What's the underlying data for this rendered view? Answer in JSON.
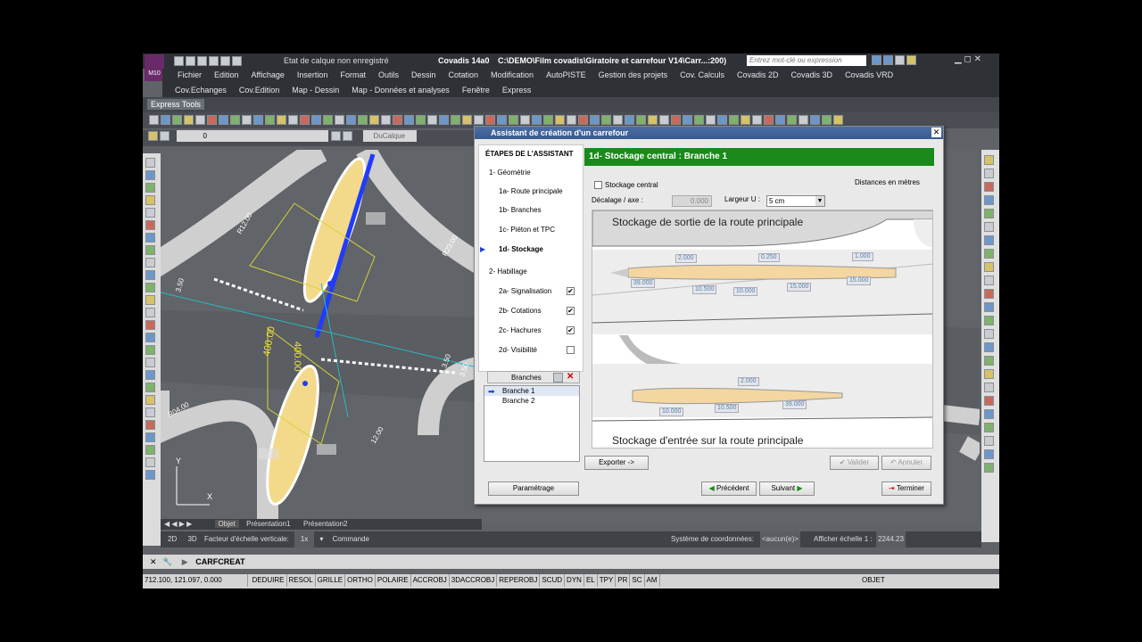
{
  "app": {
    "title": "Covadis 14a0",
    "path": "C:\\DEMO\\Film covadis\\Giratoire et carrefour V14\\Carr...:200)",
    "search_placeholder": "Entrez mot-clé ou expression",
    "layer_state": "Etat de calque non enregistré",
    "logo": "M10"
  },
  "menu": [
    "Fichier",
    "Edition",
    "Affichage",
    "Insertion",
    "Format",
    "Outils",
    "Dessin",
    "Cotation",
    "Modification",
    "AutoPISTE",
    "Gestion des projets",
    "Cov. Calculs",
    "Covadis 2D",
    "Covadis 3D",
    "Covadis VRD"
  ],
  "menu2": [
    "Cov.Echanges",
    "Cov.Edition",
    "Map - Dessin",
    "Map - Données et analyses",
    "Fenêtre",
    "Express"
  ],
  "toolbar": {
    "express_tools": "Express Tools",
    "layer_field": "0",
    "dupl_field": "DuCalque"
  },
  "dialog": {
    "title": "Assistant de création d'un carrefour",
    "steps_title": "ÉTAPES DE L'ASSISTANT",
    "steps": [
      {
        "label": "1- Géométrie"
      },
      {
        "label": "1a- Route principale"
      },
      {
        "label": "1b- Branches"
      },
      {
        "label": "1c- Piéton et TPC"
      },
      {
        "label": "1d- Stockage",
        "active": true
      },
      {
        "label": "2- Habillage"
      },
      {
        "label": "2a- Signalisation",
        "checked": true
      },
      {
        "label": "2b- Cotations",
        "checked": true
      },
      {
        "label": "2c- Hachures",
        "checked": true
      },
      {
        "label": "2d- Visibilité",
        "checked": false
      }
    ],
    "branches_label": "Branches",
    "branches": [
      "Branche 1",
      "Branche 2"
    ],
    "panel_title": "1d- Stockage central : Branche 1",
    "stockage_central": "Stockage central",
    "distances": "Distances en mètres",
    "decalage_label": "Décalage / axe :",
    "decalage_value": "0.000",
    "largeur_label": "Largeur U :",
    "largeur_value": "5 cm",
    "diagram_title_top": "Stockage de sortie de la route principale",
    "diagram_title_bottom": "Stockage d'entrée sur la route principale",
    "dims_top": [
      "2.000",
      "0.250",
      "1.000",
      "39.000",
      "10.500",
      "10.000",
      "15.000",
      "15.000"
    ],
    "dims_bottom": [
      "2.000",
      "10.000",
      "10.500",
      "39.000"
    ],
    "buttons": {
      "exporter": "Exporter ->",
      "valider": "Valider",
      "annuler": "Annuler",
      "parametrage": "Paramétrage",
      "precedent": "Précédent",
      "suivant": "Suivant",
      "terminer": "Terminer"
    }
  },
  "canvas": {
    "labels": [
      "R12.00",
      "R23.00",
      "3.50",
      "400.00",
      "400.00",
      "3.50",
      "R04.00",
      "12.00",
      "3.50"
    ]
  },
  "tabs": [
    "Objet",
    "Présentation1",
    "Présentation2"
  ],
  "statusbar": {
    "b2d": "2D",
    "b3d": "3D",
    "facteur": "Facteur d'échelle verticale:",
    "facteur_val": "1x",
    "commande": "Commande",
    "systeme": "Système de coordonnées:",
    "systeme_val": "<aucun(e)>",
    "afficher": "Afficher échelle 1 :",
    "echelle": "2244.23"
  },
  "command": {
    "text": "CARFCREAT"
  },
  "status2": {
    "coords": "712.100, 121.097, 0.000",
    "toggles": [
      "DEDUIRE",
      "RESOL",
      "GRILLE",
      "ORTHO",
      "POLAIRE",
      "ACCROBJ",
      "3DACCROBJ",
      "REPEROBJ",
      "SCUD",
      "DYN",
      "EL",
      "TPY",
      "PR",
      "SC",
      "AM"
    ],
    "objet": "OBJET"
  },
  "colors": {
    "accent": "#1a8a1a",
    "title": "#3a5a90"
  }
}
